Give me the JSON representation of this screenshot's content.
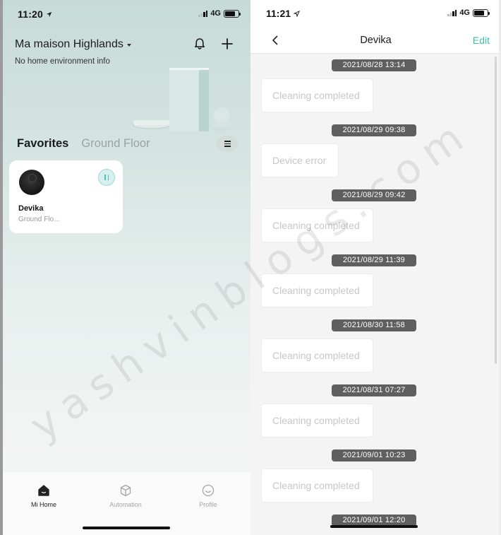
{
  "left_phone": {
    "status": {
      "time": "11:20",
      "network": "4G"
    },
    "home": {
      "title": "Ma maison Highlands",
      "subtitle": "No home environment info",
      "icons": {
        "notifications": "bell-icon",
        "add": "plus-icon"
      }
    },
    "tabs": [
      {
        "label": "Favorites",
        "active": true
      },
      {
        "label": "Ground Floor",
        "active": false
      }
    ],
    "device_card": {
      "name": "Devika",
      "room": "Ground Flo...",
      "state_icon": "pause-icon"
    },
    "bottom_nav": [
      {
        "label": "Mi Home",
        "icon": "home-icon",
        "active": true
      },
      {
        "label": "Automation",
        "icon": "cube-icon",
        "active": false
      },
      {
        "label": "Profile",
        "icon": "smiley-icon",
        "active": false
      }
    ]
  },
  "right_phone": {
    "status": {
      "time": "11:21",
      "network": "4G"
    },
    "header": {
      "title": "Devika",
      "edit_label": "Edit",
      "back_icon": "chevron-left-icon"
    },
    "log": [
      {
        "timestamp": "2021/08/28 13:14",
        "message": "Cleaning completed"
      },
      {
        "timestamp": "2021/08/29 09:38",
        "message": "Device error"
      },
      {
        "timestamp": "2021/08/29 09:42",
        "message": "Cleaning completed"
      },
      {
        "timestamp": "2021/08/29 11:39",
        "message": "Cleaning completed"
      },
      {
        "timestamp": "2021/08/30 11:58",
        "message": "Cleaning completed"
      },
      {
        "timestamp": "2021/08/31 07:27",
        "message": "Cleaning completed"
      },
      {
        "timestamp": "2021/09/01 10:23",
        "message": "Cleaning completed"
      },
      {
        "timestamp": "2021/09/01 12:20",
        "message": ""
      }
    ]
  },
  "watermark": "yashvinblogs.com",
  "colors": {
    "accent": "#3fbfa5",
    "timestamp_bg": "#5f5f5f",
    "muted_text": "#c7c7c7"
  }
}
